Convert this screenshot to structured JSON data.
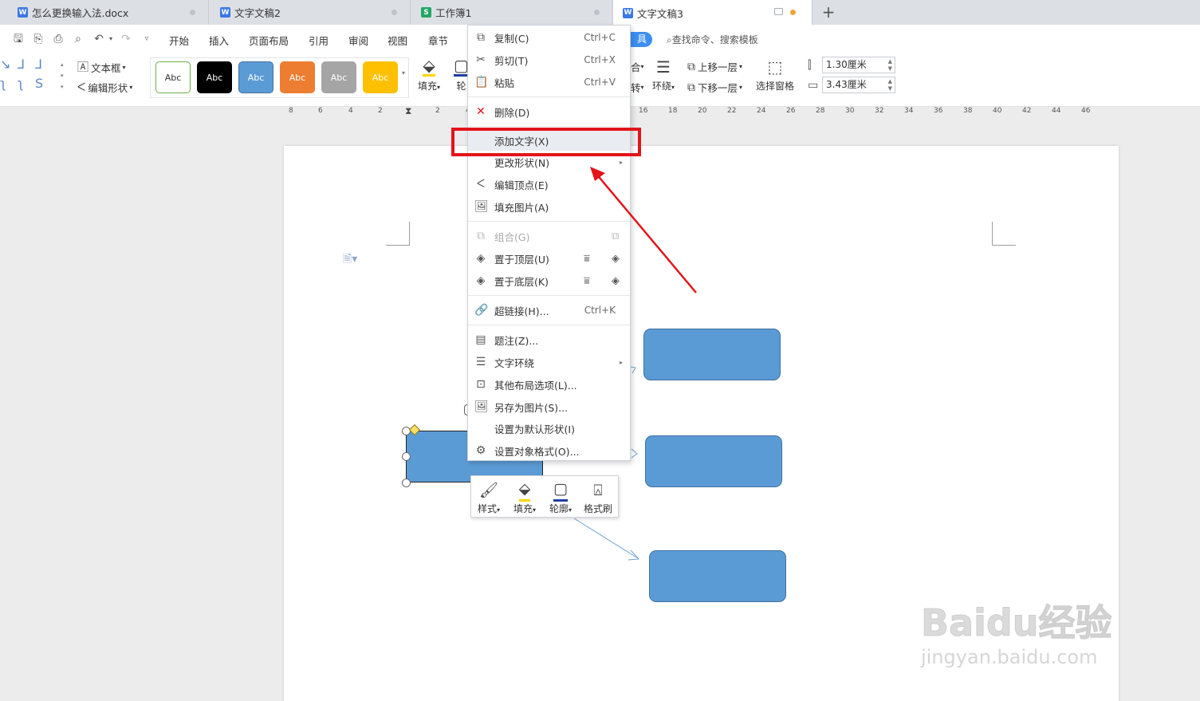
{
  "tabs": [
    {
      "label": "怎么更换输入法.docx",
      "icon": "W"
    },
    {
      "label": "文字文稿2",
      "icon": "W"
    },
    {
      "label": "工作簿1",
      "icon": "S"
    },
    {
      "label": "文字文稿3",
      "icon": "W"
    }
  ],
  "menubar": {
    "items": [
      "开始",
      "插入",
      "页面布局",
      "引用",
      "审阅",
      "视图",
      "章节"
    ],
    "tools_label": "具",
    "search_label": "查找命令、搜索模板"
  },
  "ribbon": {
    "textbox_label": "文本框",
    "edit_shape_label": "编辑形状",
    "style_label": "Abc",
    "fill_label": "填充",
    "outline_label": "轮",
    "group_label": "合",
    "rotate_label": "转",
    "wrap_label": "环绕",
    "bring_forward_label": "上移一层",
    "send_backward_label": "下移一层",
    "selection_pane_label": "选择窗格",
    "height_value": "1.30厘米",
    "width_value": "3.43厘米"
  },
  "ruler": {
    "labels": [
      "8",
      "6",
      "4",
      "2",
      "",
      "2",
      "4",
      "16",
      "18",
      "20",
      "22",
      "24",
      "26",
      "28",
      "30",
      "32",
      "34",
      "36",
      "38",
      "40",
      "42",
      "44",
      "46"
    ]
  },
  "context_menu": {
    "copy": {
      "label": "复制(C)",
      "shortcut": "Ctrl+C"
    },
    "cut": {
      "label": "剪切(T)",
      "shortcut": "Ctrl+X"
    },
    "paste": {
      "label": "粘贴",
      "shortcut": "Ctrl+V"
    },
    "delete": {
      "label": "删除(D)"
    },
    "add_text": {
      "label": "添加文字(X)"
    },
    "change_shape": {
      "label": "更改形状(N)"
    },
    "edit_points": {
      "label": "编辑顶点(E)"
    },
    "fill_picture": {
      "label": "填充图片(A)"
    },
    "group": {
      "label": "组合(G)"
    },
    "bring_to_front": {
      "label": "置于顶层(U)"
    },
    "send_to_back": {
      "label": "置于底层(K)"
    },
    "hyperlink": {
      "label": "超链接(H)...",
      "shortcut": "Ctrl+K"
    },
    "caption": {
      "label": "题注(Z)..."
    },
    "text_wrap": {
      "label": "文字环绕"
    },
    "other_layout": {
      "label": "其他布局选项(L)..."
    },
    "save_as_image": {
      "label": "另存为图片(S)..."
    },
    "set_default_shape": {
      "label": "设置为默认形状(I)"
    },
    "format_object": {
      "label": "设置对象格式(O)..."
    }
  },
  "mini_toolbar": {
    "style": "样式",
    "fill": "填充",
    "outline": "轮廓",
    "format_painter": "格式刷"
  },
  "watermark": {
    "logo": "Baidu经验",
    "url": "jingyan.baidu.com"
  },
  "colors": {
    "accent": "#3d8ef5",
    "shape_fill": "#5b9bd5",
    "highlight": "#e3141b"
  }
}
